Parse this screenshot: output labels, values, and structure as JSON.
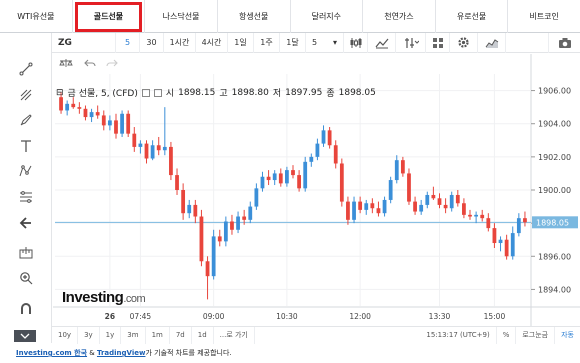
{
  "tabs": [
    {
      "label": "WTI유선물"
    },
    {
      "label": "골드선물",
      "active": true
    },
    {
      "label": "나스닥선물"
    },
    {
      "label": "항셍선물"
    },
    {
      "label": "달러지수"
    },
    {
      "label": "천연가스"
    },
    {
      "label": "유로선물"
    },
    {
      "label": "비트코인"
    }
  ],
  "toolbar": {
    "symbol": "ZG",
    "intervals": [
      "5",
      "30",
      "1시간",
      "4시간",
      "1일",
      "1주",
      "1달"
    ],
    "selected_interval": "5",
    "dropdown_value": "5"
  },
  "legend": {
    "title": "금 선물, 5, (CFD)",
    "open_label": "시",
    "open": "1898.15",
    "high_label": "고",
    "high": "1898.80",
    "low_label": "저",
    "low": "1897.95",
    "close_label": "종",
    "close": "1898.05"
  },
  "logo": {
    "brand": "Investing",
    "suffix": ".com"
  },
  "bottombar": {
    "ranges": [
      "10y",
      "3y",
      "1y",
      "3m",
      "1m",
      "7d",
      "1d"
    ],
    "goto": "...로 가기",
    "time": "15:13:17 (UTC+9)",
    "percent": "%",
    "log": "로그눈금",
    "auto": "자동"
  },
  "footer": {
    "link1": "Investing.com 한국",
    "amp": " & ",
    "link2": "TradingView",
    "rest": "가 기술적 차트를 제공합니다."
  },
  "colors": {
    "up": "#26a69a",
    "down": "#ef5350",
    "up_fill": "#3b8fd8",
    "down_fill": "#e8453c",
    "price_line": "#7ab8e0",
    "active_tab_border": "#e31e24"
  },
  "chart_data": {
    "type": "candlestick",
    "ylim": [
      1893,
      1907
    ],
    "yticks": [
      1894.0,
      1896.0,
      1898.0,
      1900.0,
      1902.0,
      1904.0,
      1906.0
    ],
    "current_price": "1898.05",
    "xticks": [
      "26",
      "07:45",
      "09:00",
      "10:30",
      "12:00",
      "13:30",
      "15:00"
    ],
    "candles": [
      [
        1905.6,
        1905.9,
        1904.6,
        1904.8
      ],
      [
        1904.8,
        1905.4,
        1904.5,
        1905.2
      ],
      [
        1905.2,
        1905.6,
        1904.9,
        1905.0
      ],
      [
        1905.0,
        1905.3,
        1904.6,
        1904.9
      ],
      [
        1904.9,
        1905.1,
        1904.2,
        1904.4
      ],
      [
        1904.4,
        1904.9,
        1904.1,
        1904.7
      ],
      [
        1904.7,
        1905.1,
        1904.3,
        1904.5
      ],
      [
        1904.5,
        1904.8,
        1903.6,
        1903.9
      ],
      [
        1903.9,
        1904.5,
        1903.6,
        1904.2
      ],
      [
        1904.2,
        1904.6,
        1903.1,
        1903.4
      ],
      [
        1903.4,
        1904.8,
        1903.2,
        1904.6
      ],
      [
        1904.6,
        1904.8,
        1903.2,
        1903.4
      ],
      [
        1903.4,
        1903.8,
        1902.3,
        1902.6
      ],
      [
        1902.6,
        1903.0,
        1902.2,
        1902.8
      ],
      [
        1902.8,
        1903.0,
        1901.6,
        1901.9
      ],
      [
        1901.9,
        1903.0,
        1901.8,
        1902.7
      ],
      [
        1902.7,
        1903.2,
        1902.1,
        1902.4
      ],
      [
        1902.4,
        1905.0,
        1902.1,
        1902.6
      ],
      [
        1902.6,
        1902.9,
        1900.6,
        1900.9
      ],
      [
        1900.9,
        1901.3,
        1899.7,
        1900.0
      ],
      [
        1900.0,
        1900.4,
        1898.2,
        1898.6
      ],
      [
        1898.6,
        1899.4,
        1898.3,
        1899.1
      ],
      [
        1899.1,
        1899.4,
        1898.0,
        1898.4
      ],
      [
        1898.4,
        1898.8,
        1895.4,
        1895.7
      ],
      [
        1895.7,
        1896.0,
        1893.4,
        1894.8
      ],
      [
        1894.8,
        1897.6,
        1894.6,
        1897.2
      ],
      [
        1897.2,
        1897.6,
        1896.6,
        1896.9
      ],
      [
        1896.9,
        1898.4,
        1896.6,
        1898.1
      ],
      [
        1898.1,
        1898.5,
        1897.3,
        1897.6
      ],
      [
        1897.6,
        1898.7,
        1897.4,
        1898.4
      ],
      [
        1898.4,
        1898.8,
        1897.9,
        1898.2
      ],
      [
        1898.2,
        1899.3,
        1898.0,
        1899.0
      ],
      [
        1899.0,
        1900.4,
        1898.8,
        1900.1
      ],
      [
        1900.1,
        1901.1,
        1899.9,
        1900.8
      ],
      [
        1900.8,
        1901.2,
        1900.3,
        1900.6
      ],
      [
        1900.6,
        1901.2,
        1900.3,
        1901.0
      ],
      [
        1901.0,
        1901.3,
        1900.2,
        1900.4
      ],
      [
        1900.4,
        1901.4,
        1900.2,
        1901.2
      ],
      [
        1901.2,
        1901.5,
        1900.7,
        1900.9
      ],
      [
        1900.9,
        1901.2,
        1899.9,
        1900.1
      ],
      [
        1900.1,
        1902.0,
        1899.9,
        1901.7
      ],
      [
        1901.7,
        1902.2,
        1901.4,
        1902.0
      ],
      [
        1902.0,
        1903.1,
        1901.8,
        1902.8
      ],
      [
        1902.8,
        1903.9,
        1902.6,
        1903.6
      ],
      [
        1903.6,
        1903.8,
        1902.5,
        1902.7
      ],
      [
        1902.7,
        1903.0,
        1901.3,
        1901.6
      ],
      [
        1901.6,
        1901.9,
        1899.0,
        1899.3
      ],
      [
        1899.3,
        1899.6,
        1897.9,
        1898.2
      ],
      [
        1898.2,
        1899.6,
        1898.0,
        1899.3
      ],
      [
        1899.3,
        1899.6,
        1898.6,
        1898.8
      ],
      [
        1898.8,
        1899.4,
        1898.5,
        1899.2
      ],
      [
        1899.2,
        1899.5,
        1898.6,
        1898.9
      ],
      [
        1898.9,
        1899.3,
        1898.4,
        1898.6
      ],
      [
        1898.6,
        1899.6,
        1898.4,
        1899.4
      ],
      [
        1899.4,
        1900.8,
        1899.2,
        1900.6
      ],
      [
        1900.6,
        1902.1,
        1900.4,
        1901.8
      ],
      [
        1901.8,
        1902.0,
        1900.8,
        1901.0
      ],
      [
        1901.0,
        1901.3,
        1899.1,
        1899.3
      ],
      [
        1899.3,
        1899.6,
        1898.5,
        1898.7
      ],
      [
        1898.7,
        1899.4,
        1898.5,
        1899.1
      ],
      [
        1899.1,
        1899.9,
        1898.9,
        1899.7
      ],
      [
        1899.7,
        1900.2,
        1899.4,
        1899.5
      ],
      [
        1899.5,
        1899.8,
        1898.9,
        1899.1
      ],
      [
        1899.1,
        1899.5,
        1898.6,
        1898.9
      ],
      [
        1898.9,
        1899.9,
        1898.7,
        1899.7
      ],
      [
        1899.7,
        1900.0,
        1899.0,
        1899.2
      ],
      [
        1899.2,
        1899.5,
        1898.3,
        1898.5
      ],
      [
        1898.5,
        1898.8,
        1898.2,
        1898.4
      ],
      [
        1898.4,
        1898.7,
        1898.0,
        1898.5
      ],
      [
        1898.5,
        1898.8,
        1898.1,
        1898.3
      ],
      [
        1898.3,
        1898.6,
        1897.5,
        1897.7
      ],
      [
        1897.7,
        1898.0,
        1896.5,
        1896.8
      ],
      [
        1896.8,
        1897.2,
        1896.3,
        1897.0
      ],
      [
        1897.0,
        1897.3,
        1895.8,
        1896.0
      ],
      [
        1896.0,
        1897.8,
        1895.8,
        1897.4
      ],
      [
        1897.4,
        1898.6,
        1897.2,
        1898.3
      ],
      [
        1898.3,
        1898.7,
        1897.8,
        1898.05
      ]
    ]
  }
}
